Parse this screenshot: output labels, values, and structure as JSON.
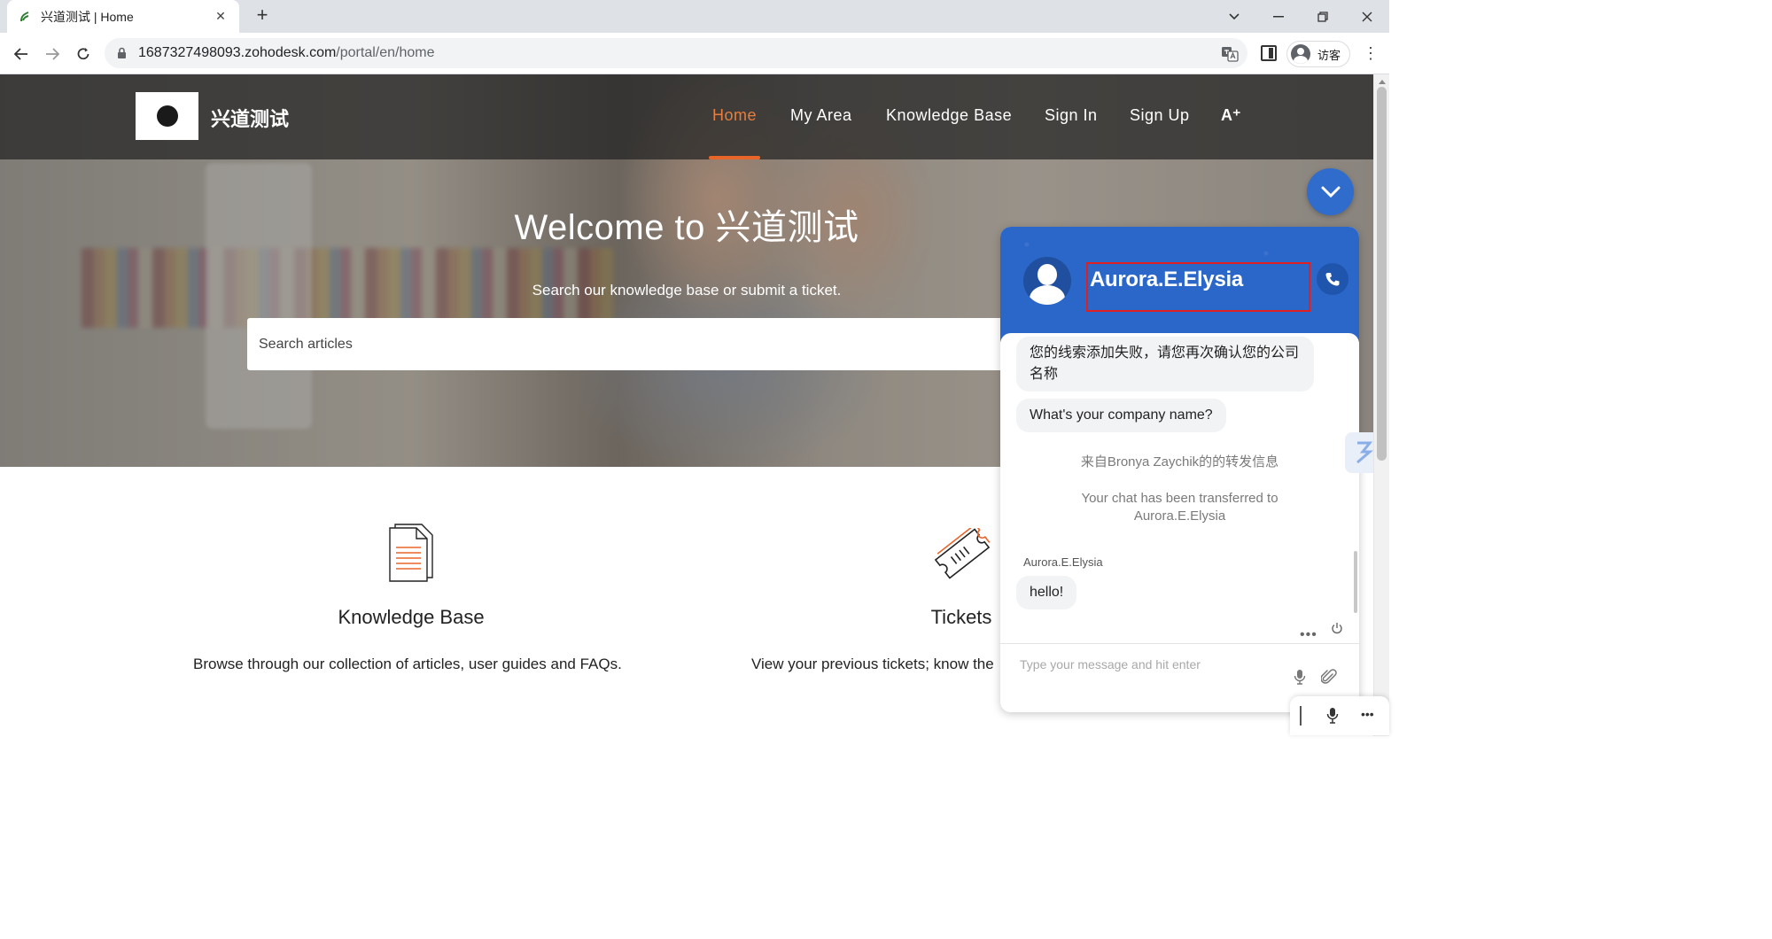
{
  "browser": {
    "tab_title": "兴道测试 | Home",
    "tab_close": "✕",
    "new_tab": "+",
    "url_host": "1687327498093.zohodesk.com",
    "url_path": "/portal/en/home",
    "profile_label": "访客"
  },
  "header": {
    "brand": "兴道测试",
    "nav": {
      "home": "Home",
      "my_area": "My Area",
      "knowledge_base": "Knowledge Base",
      "sign_in": "Sign In",
      "sign_up": "Sign Up"
    },
    "accessibility_label": "A⁺"
  },
  "hero": {
    "welcome": "Welcome to 兴道测试",
    "subtitle": "Search our knowledge base or submit a ticket.",
    "search_placeholder": "Search articles"
  },
  "cards": {
    "kb": {
      "icon": "document-icon",
      "title": "Knowledge Base",
      "desc": "Browse through our collection of articles, user guides and FAQs."
    },
    "tickets": {
      "icon": "ticket-icon",
      "title": "Tickets",
      "desc": "View your previous tickets; know the"
    }
  },
  "chat": {
    "agent_name": "Aurora.E.Elysia",
    "messages": {
      "m1": "您的线索添加失败，请您再次确认您的公司名称",
      "m2": "What's your company name?",
      "sys1": "来自Bronya Zaychik的的转发信息",
      "sys2": "Your chat has been transferred to Aurora.E.Elysia",
      "sender": "Aurora.E.Elysia",
      "m3": "hello!"
    },
    "input_placeholder": "Type your message and hit enter",
    "more": "•••"
  },
  "colors": {
    "accent_orange": "#e8652a",
    "chat_blue": "#2b66c9",
    "highlight_red": "#e02020"
  }
}
